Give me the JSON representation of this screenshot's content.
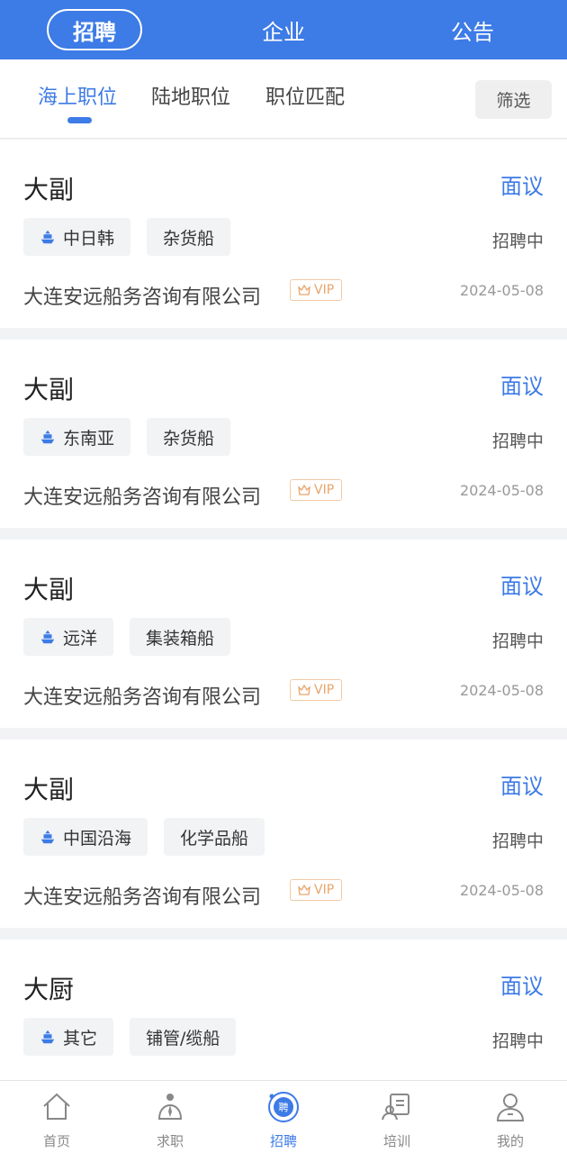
{
  "header": {
    "tabs": [
      {
        "label": "招聘",
        "active": true
      },
      {
        "label": "企业",
        "active": false
      },
      {
        "label": "公告",
        "active": false
      }
    ]
  },
  "subnav": {
    "tabs": [
      {
        "label": "海上职位",
        "active": true
      },
      {
        "label": "陆地职位",
        "active": false
      },
      {
        "label": "职位匹配",
        "active": false
      }
    ],
    "filter_label": "筛选"
  },
  "jobs": [
    {
      "title": "大副",
      "salary": "面议",
      "route": "中日韩",
      "ship_type": "杂货船",
      "status": "招聘中",
      "company": "大连安远船务咨询有限公司",
      "badge": "VIP",
      "date": "2024-05-08"
    },
    {
      "title": "大副",
      "salary": "面议",
      "route": "东南亚",
      "ship_type": "杂货船",
      "status": "招聘中",
      "company": "大连安远船务咨询有限公司",
      "badge": "VIP",
      "date": "2024-05-08"
    },
    {
      "title": "大副",
      "salary": "面议",
      "route": "远洋",
      "ship_type": "集装箱船",
      "status": "招聘中",
      "company": "大连安远船务咨询有限公司",
      "badge": "VIP",
      "date": "2024-05-08"
    },
    {
      "title": "大副",
      "salary": "面议",
      "route": "中国沿海",
      "ship_type": "化学品船",
      "status": "招聘中",
      "company": "大连安远船务咨询有限公司",
      "badge": "VIP",
      "date": "2024-05-08"
    },
    {
      "title": "大厨",
      "salary": "面议",
      "route": "其它",
      "ship_type": "铺管/缆船",
      "status": "招聘中"
    }
  ],
  "bottom_nav": [
    {
      "label": "首页",
      "icon": "home-icon",
      "active": false
    },
    {
      "label": "求职",
      "icon": "job-seeker-icon",
      "active": false
    },
    {
      "label": "招聘",
      "icon": "recruit-icon",
      "active": true
    },
    {
      "label": "培训",
      "icon": "training-icon",
      "active": false
    },
    {
      "label": "我的",
      "icon": "profile-icon",
      "active": false
    }
  ],
  "colors": {
    "primary": "#3d7be6",
    "vip": "#e9a46a"
  }
}
